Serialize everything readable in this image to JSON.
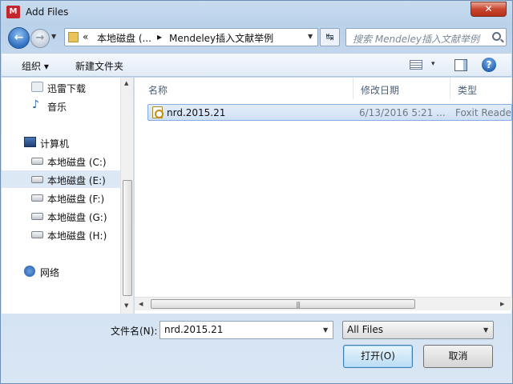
{
  "window": {
    "title": "Add Files",
    "app_icon_text": "M",
    "close_glyph": "✕"
  },
  "navbar": {
    "back_glyph": "←",
    "forward_glyph": "→",
    "breadcrumb": [
      "«",
      "本地磁盘 (...",
      "▸",
      "Mendeley插入文献举例"
    ],
    "refresh_glyph": "↹",
    "search_placeholder": "搜索 Mendeley插入文献举例"
  },
  "toolbar": {
    "organize": "组织 ▾",
    "new_folder": "新建文件夹",
    "view_arrow": "▾",
    "help": "?"
  },
  "sidebar": {
    "items": [
      {
        "label": "迅雷下载",
        "icon": "download-icon"
      },
      {
        "label": "音乐",
        "icon": "music-icon"
      },
      {
        "label": "计算机",
        "icon": "computer-icon"
      },
      {
        "label": "本地磁盘 (C:)",
        "icon": "system-drive-icon"
      },
      {
        "label": "本地磁盘 (E:)",
        "icon": "drive-icon",
        "selected": true
      },
      {
        "label": "本地磁盘 (F:)",
        "icon": "drive-icon"
      },
      {
        "label": "本地磁盘 (G:)",
        "icon": "drive-icon"
      },
      {
        "label": "本地磁盘 (H:)",
        "icon": "drive-icon"
      },
      {
        "label": "网络",
        "icon": "network-icon"
      }
    ]
  },
  "file_list": {
    "columns": [
      "名称",
      "修改日期",
      "类型"
    ],
    "sort_glyph": "^",
    "rows": [
      {
        "name": "nrd.2015.21",
        "modified": "6/13/2016 5:21 ...",
        "type": "Foxit Reade"
      }
    ],
    "grip": "|||"
  },
  "footer": {
    "filename_label": "文件名(N):",
    "filename_value": "nrd.2015.21",
    "filter_value": "All Files",
    "open_button": "打开(O)",
    "cancel_button": "取消",
    "dropdown_glyph": "▼"
  }
}
